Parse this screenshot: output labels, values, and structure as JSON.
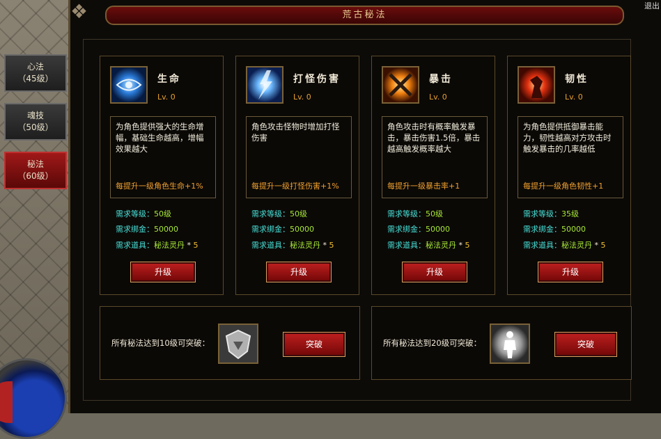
{
  "window": {
    "title": "荒古秘法",
    "close_label": "退出"
  },
  "side_tabs": [
    {
      "name": "心法",
      "level": "（45级）",
      "active": false
    },
    {
      "name": "魂技",
      "level": "（50级）",
      "active": false
    },
    {
      "name": "秘法",
      "level": "（60级）",
      "active": true
    }
  ],
  "skills": [
    {
      "name": "生命",
      "level": "Lv. 0",
      "icon": "eye-icon",
      "desc": "为角色提供强大的生命增幅，基础生命越高，增幅效果越大",
      "increment": "每提升一级角色生命+1%",
      "req_level_label": "需求等级：",
      "req_level": "50级",
      "req_gold_label": "需求绑金：",
      "req_gold": "50000",
      "req_item_label": "需求道具：",
      "req_item": "秘法灵丹",
      "req_item_mult": "*",
      "req_item_count": "5",
      "button": "升级"
    },
    {
      "name": "打怪伤害",
      "level": "Lv. 0",
      "icon": "lightning-icon",
      "desc": "角色攻击怪物时增加打怪伤害",
      "increment": "每提升一级打怪伤害+1%",
      "req_level_label": "需求等级：",
      "req_level": "50级",
      "req_gold_label": "需求绑金：",
      "req_gold": "50000",
      "req_item_label": "需求道具：",
      "req_item": "秘法灵丹",
      "req_item_mult": "*",
      "req_item_count": "5",
      "button": "升级"
    },
    {
      "name": "暴击",
      "level": "Lv. 0",
      "icon": "crossed-axes-icon",
      "desc": "角色攻击时有概率触发暴击，暴击伤害1.5倍，暴击越高触发概率越大",
      "increment": "每提升一级暴击率+1",
      "req_level_label": "需求等级：",
      "req_level": "50级",
      "req_gold_label": "需求绑金：",
      "req_gold": "50000",
      "req_item_label": "需求道具：",
      "req_item": "秘法灵丹",
      "req_item_mult": "*",
      "req_item_count": "5",
      "button": "升级"
    },
    {
      "name": "韧性",
      "level": "Lv. 0",
      "icon": "flame-warrior-icon",
      "desc": "为角色提供抵御暴击能力，韧性越高对方攻击时触发暴击的几率越低",
      "increment": "每提升一级角色韧性+1",
      "req_level_label": "需求等级：",
      "req_level": "35级",
      "req_gold_label": "需求绑金：",
      "req_gold": "50000",
      "req_item_label": "需求道具：",
      "req_item": "秘法灵丹",
      "req_item_mult": "*",
      "req_item_count": "5",
      "button": "升级"
    }
  ],
  "breakthroughs": [
    {
      "label": "所有秘法达到10级可突破：",
      "icon": "shield-emblem-icon",
      "button": "突破"
    },
    {
      "label": "所有秘法达到20级可突破：",
      "icon": "glowing-figure-icon",
      "button": "突破"
    }
  ],
  "colors": {
    "accent_red": "#a01818",
    "req_label": "#48e0d8",
    "req_value": "#a8e838",
    "level": "#e8a030",
    "increment": "#f0a030"
  }
}
